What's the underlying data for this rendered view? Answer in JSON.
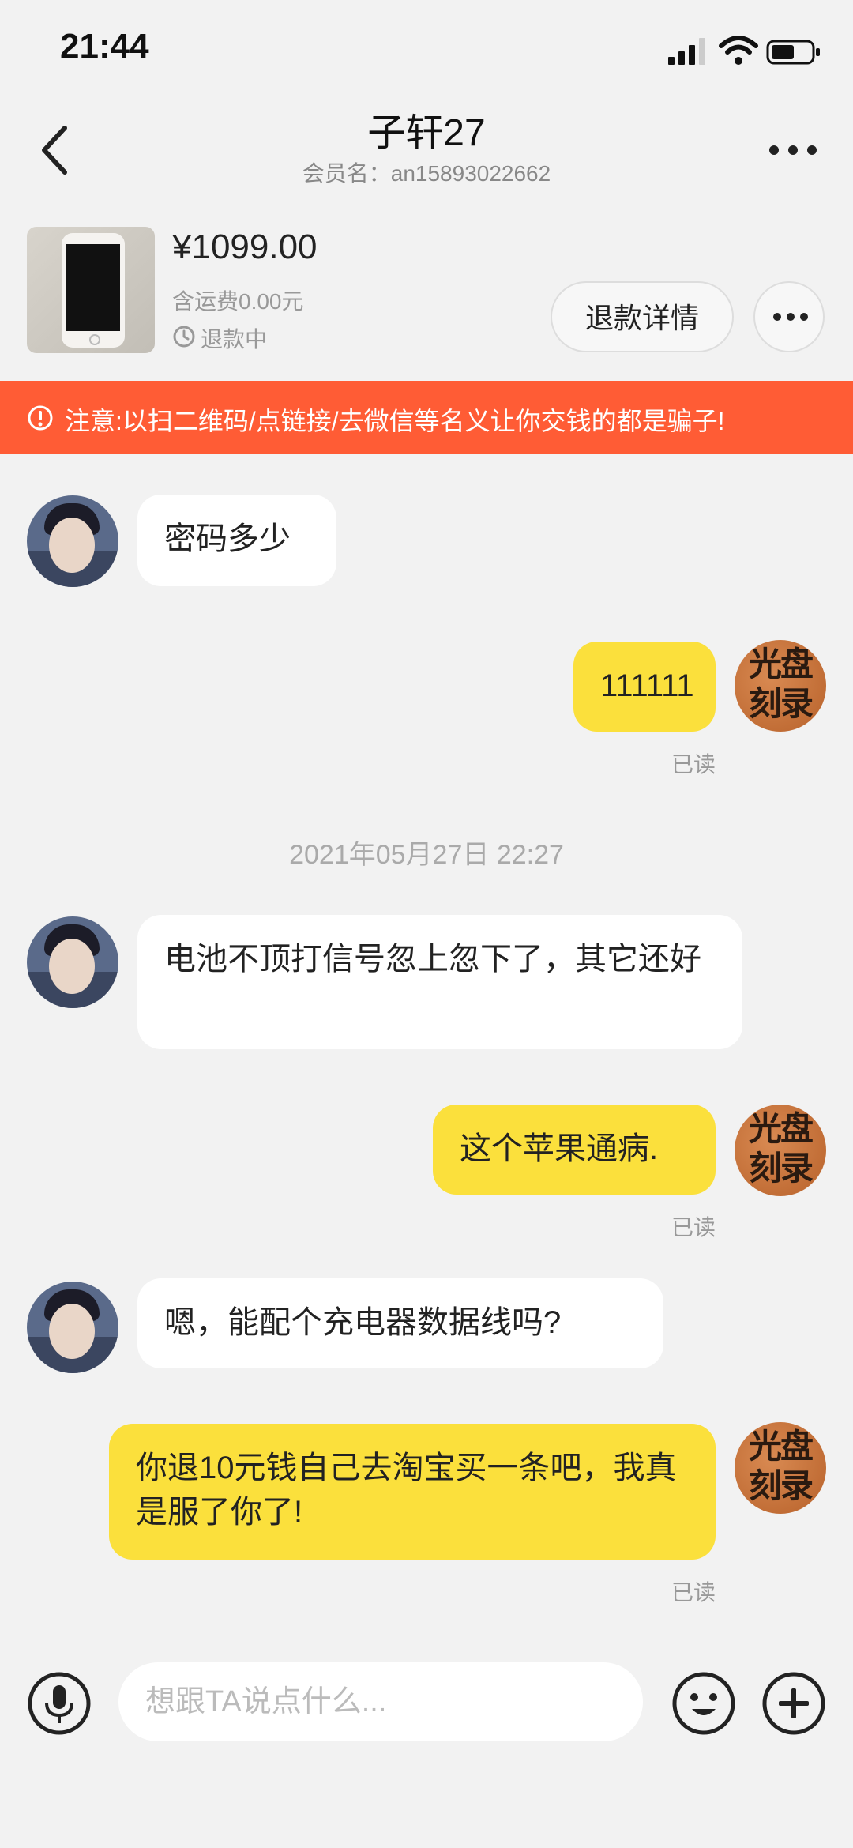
{
  "status_bar": {
    "time": "21:44"
  },
  "header": {
    "title": "子轩27",
    "subtitle": "会员名：an15893022662"
  },
  "product": {
    "price": "¥1099.00",
    "shipping": "含运费0.00元",
    "status": "退款中",
    "refund_button": "退款详情"
  },
  "warning": {
    "text": "注意:以扫二维码/点链接/去微信等名义让你交钱的都是骗子!"
  },
  "avatar_right_text": [
    "光盘",
    "刻录"
  ],
  "messages": [
    {
      "side": "in",
      "text": "密码多少"
    },
    {
      "side": "out",
      "text": "111111",
      "read": "已读"
    },
    {
      "side": "in",
      "text": "电池不顶打信号忽上忽下了，其它还好"
    },
    {
      "side": "out",
      "text": "这个苹果通病.",
      "read": "已读"
    },
    {
      "side": "in",
      "text": "嗯，能配个充电器数据线吗?"
    },
    {
      "side": "out",
      "text": "你退10元钱自己去淘宝买一条吧，我真是服了你了!",
      "read": "已读"
    }
  ],
  "timestamp": "2021年05月27日  22:27",
  "input": {
    "placeholder": "想跟TA说点什么..."
  },
  "colors": {
    "banner": "#ff5c35",
    "outgoing_bubble": "#fbe03c",
    "incoming_bubble": "#ffffff",
    "background": "#f2f2f2"
  }
}
